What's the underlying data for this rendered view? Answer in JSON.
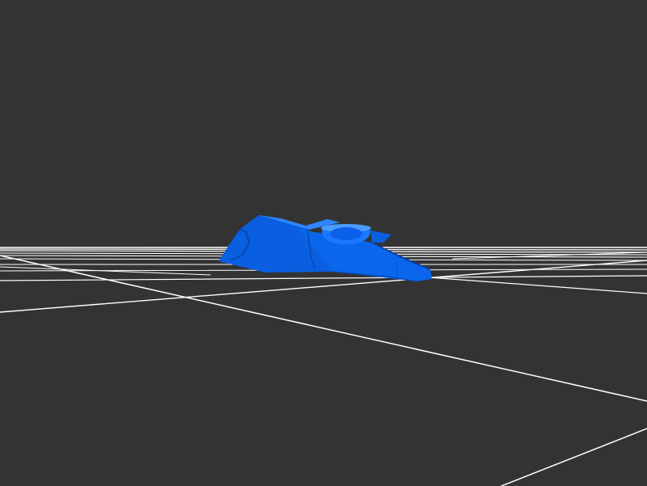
{
  "viewport": {
    "background_color": "#333333",
    "grid_color": "#ffffff",
    "model_color": "#0a5fe0",
    "model_highlight_color": "#2f86ff",
    "model_shadow_color": "#0848b0"
  },
  "scene": {
    "objects": [
      {
        "name": "grid-floor",
        "kind": "grid"
      },
      {
        "name": "model",
        "kind": "mesh"
      }
    ]
  }
}
